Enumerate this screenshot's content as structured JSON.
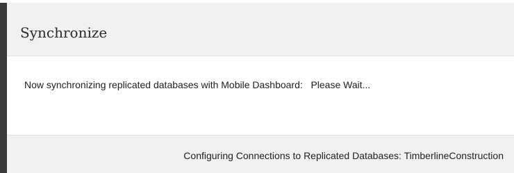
{
  "dialog": {
    "title": "Synchronize",
    "message": "Now synchronizing replicated databases with Mobile Dashboard:   Please Wait...",
    "status": "Configuring Connections to Replicated Databases: TimberlineConstruction"
  },
  "colors": {
    "header_bg": "#f1f1f1",
    "body_bg": "#ffffff",
    "left_edge": "#3a3a3a",
    "text": "#222222"
  }
}
